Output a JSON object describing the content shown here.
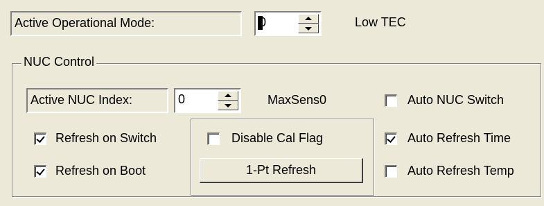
{
  "top": {
    "mode_label": "Active Operational Mode:",
    "mode_value": "0",
    "mode_name": "Low TEC"
  },
  "nuc": {
    "group_title": "NUC Control",
    "index_label": "Active NUC Index:",
    "index_value": "0",
    "index_name": "MaxSens0",
    "refresh_on_switch": {
      "label": "Refresh on Switch",
      "checked": true
    },
    "refresh_on_boot": {
      "label": "Refresh on Boot",
      "checked": true
    },
    "disable_cal_flag": {
      "label": "Disable Cal Flag",
      "checked": false
    },
    "one_pt_refresh_label": "1-Pt Refresh",
    "auto_nuc_switch": {
      "label": "Auto NUC Switch",
      "checked": false
    },
    "auto_refresh_time": {
      "label": "Auto Refresh Time",
      "checked": true
    },
    "auto_refresh_temp": {
      "label": "Auto Refresh Temp",
      "checked": false
    }
  },
  "colors": {
    "background": "#ECE9D8",
    "field": "#FFFFFF",
    "shadow": "#808080"
  }
}
